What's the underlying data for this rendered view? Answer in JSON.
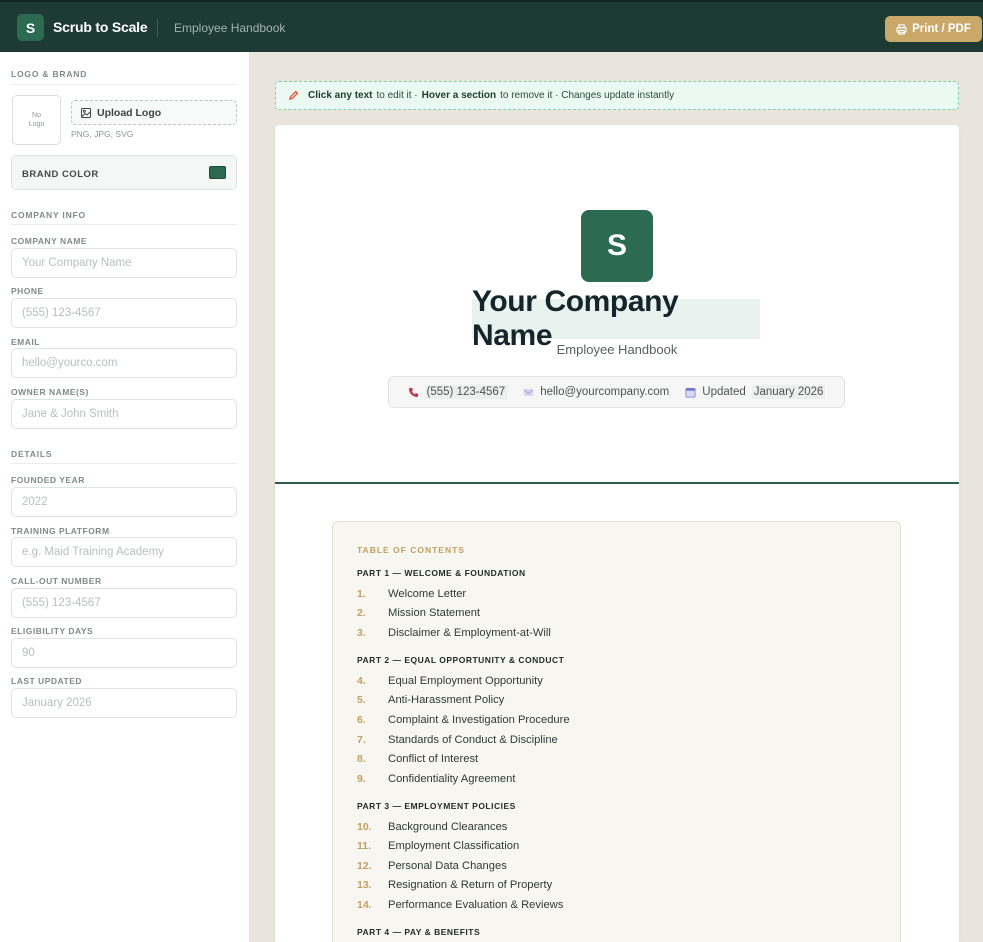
{
  "topbar": {
    "badge": "S",
    "app_name": "Scrub to Scale",
    "doc_name": "Employee Handbook",
    "print_label": "Print / PDF"
  },
  "sidebar": {
    "logo_brand_title": "LOGO & BRAND",
    "logo_placeholder_line1": "No",
    "logo_placeholder_line2": "Logo",
    "upload_label": "Upload Logo",
    "upload_hint": "PNG, JPG, SVG",
    "brand_color_label": "BRAND COLOR",
    "brand_color": "#2d6a52",
    "company_info_title": "COMPANY INFO",
    "details_title": "DETAILS",
    "fields": {
      "company_name": {
        "label": "COMPANY NAME",
        "placeholder": "Your Company Name"
      },
      "phone": {
        "label": "PHONE",
        "placeholder": "(555) 123-4567"
      },
      "email": {
        "label": "EMAIL",
        "placeholder": "hello@yourco.com"
      },
      "owner": {
        "label": "OWNER NAME(S)",
        "placeholder": "Jane & John Smith"
      },
      "founded": {
        "label": "FOUNDED YEAR",
        "placeholder": "2022"
      },
      "training": {
        "label": "TRAINING PLATFORM",
        "placeholder": "e.g. Maid Training Academy"
      },
      "callout": {
        "label": "CALL-OUT NUMBER",
        "placeholder": "(555) 123-4567"
      },
      "eligibility": {
        "label": "ELIGIBILITY DAYS",
        "placeholder": "90"
      },
      "last_updated": {
        "label": "LAST UPDATED",
        "placeholder": "January 2026"
      }
    }
  },
  "hint": {
    "part1_bold": "Click any text",
    "part1": "to edit it ·",
    "part2_bold": "Hover a section",
    "part2": "to remove it · Changes update instantly"
  },
  "cover": {
    "logo_letter": "S",
    "title": "Your Company Name",
    "subtitle": "Employee Handbook",
    "phone": "(555) 123-4567",
    "email": "hello@yourcompany.com",
    "updated_label": "Updated",
    "updated_value": "January 2026"
  },
  "toc": {
    "title": "TABLE OF CONTENTS",
    "parts": [
      {
        "title": "PART 1 — WELCOME & FOUNDATION",
        "items": [
          {
            "num": "1.",
            "label": "Welcome Letter"
          },
          {
            "num": "2.",
            "label": "Mission Statement"
          },
          {
            "num": "3.",
            "label": "Disclaimer & Employment-at-Will"
          }
        ]
      },
      {
        "title": "PART 2 — EQUAL OPPORTUNITY & CONDUCT",
        "items": [
          {
            "num": "4.",
            "label": "Equal Employment Opportunity"
          },
          {
            "num": "5.",
            "label": "Anti-Harassment Policy"
          },
          {
            "num": "6.",
            "label": "Complaint & Investigation Procedure"
          },
          {
            "num": "7.",
            "label": "Standards of Conduct & Discipline"
          },
          {
            "num": "8.",
            "label": "Conflict of Interest"
          },
          {
            "num": "9.",
            "label": "Confidentiality Agreement"
          }
        ]
      },
      {
        "title": "PART 3 — EMPLOYMENT POLICIES",
        "items": [
          {
            "num": "10.",
            "label": "Background Clearances"
          },
          {
            "num": "11.",
            "label": "Employment Classification"
          },
          {
            "num": "12.",
            "label": "Personal Data Changes"
          },
          {
            "num": "13.",
            "label": "Resignation & Return of Property"
          },
          {
            "num": "14.",
            "label": "Performance Evaluation & Reviews"
          }
        ]
      },
      {
        "title": "PART 4 — PAY & BENEFITS",
        "items": []
      }
    ]
  }
}
